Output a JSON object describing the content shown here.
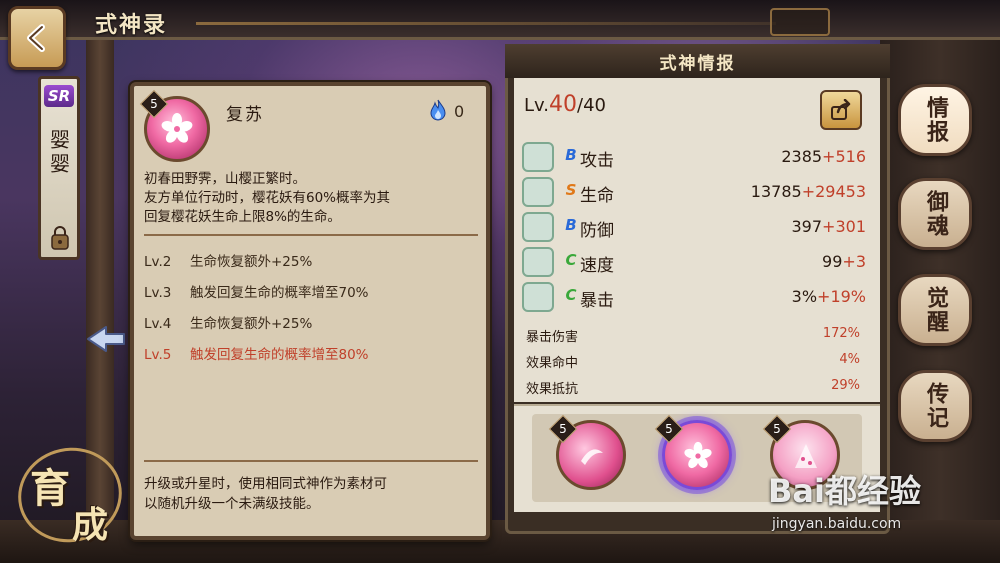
{
  "header": {
    "title": "式神录"
  },
  "shikigami": {
    "rarity": "SR",
    "name": "婴婴"
  },
  "emblem": {
    "char1": "育",
    "char2": "成"
  },
  "skill": {
    "level_badge": "5",
    "name": "复苏",
    "cost": "0",
    "description": [
      "初春田野霁，山樱正繁时。",
      "友方单位行动时，樱花妖有60%概率为其",
      "回复樱花妖生命上限8%的生命。"
    ],
    "levels": [
      {
        "lv": "Lv.2",
        "text": "生命恢复额外+25%",
        "active": false
      },
      {
        "lv": "Lv.3",
        "text": "触发回复生命的概率增至70%",
        "active": false
      },
      {
        "lv": "Lv.4",
        "text": "生命恢复额外+25%",
        "active": false
      },
      {
        "lv": "Lv.5",
        "text": "触发回复生命的概率增至80%",
        "active": true
      }
    ],
    "footer": [
      "升级或升星时，使用相同式神作为素材可",
      "以随机升级一个未满级技能。"
    ]
  },
  "info": {
    "title": "式神情报",
    "lv_prefix": "Lv.",
    "lv_current": "40",
    "lv_max": "/40",
    "stats": [
      {
        "icon": "attack-icon",
        "grade": "B",
        "name": "攻击",
        "base": "2385",
        "bonus": "+516"
      },
      {
        "icon": "health-icon",
        "grade": "S",
        "name": "生命",
        "base": "13785",
        "bonus": "+29453"
      },
      {
        "icon": "defense-icon",
        "grade": "B",
        "name": "防御",
        "base": "397",
        "bonus": "+301"
      },
      {
        "icon": "speed-icon",
        "grade": "C",
        "name": "速度",
        "base": "99",
        "bonus": "+3"
      },
      {
        "icon": "crit-icon",
        "grade": "C",
        "name": "暴击",
        "base": "3%",
        "bonus": "+19%"
      }
    ],
    "sub_stats": [
      {
        "name": "暴击伤害",
        "value": "172%"
      },
      {
        "name": "效果命中",
        "value": "4%"
      },
      {
        "name": "效果抵抗",
        "value": "29%"
      }
    ],
    "skill_slots": [
      {
        "level": "5",
        "selected": false
      },
      {
        "level": "5",
        "selected": true
      },
      {
        "level": "5",
        "selected": false
      }
    ]
  },
  "tabs": [
    {
      "label": "情报",
      "active": true
    },
    {
      "label": "御魂",
      "active": false
    },
    {
      "label": "觉醒",
      "active": false
    },
    {
      "label": "传记",
      "active": false
    }
  ],
  "watermark": {
    "logo": "Bai都经验",
    "url": "jingyan.baidu.com"
  },
  "colors": {
    "highlight": "#c0402a",
    "grade_B": "#2a6ad8",
    "grade_S": "#e07818",
    "grade_C": "#3aa83a",
    "selected": "#7a4ad8"
  }
}
